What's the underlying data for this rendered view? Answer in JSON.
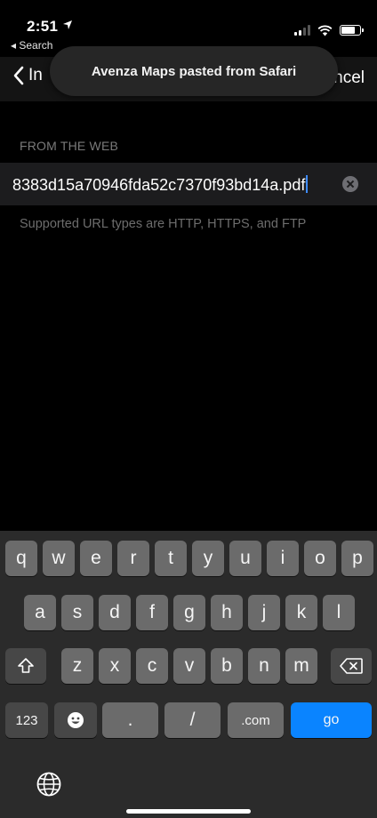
{
  "status_bar": {
    "time": "2:51",
    "back_app": "◂ Search"
  },
  "nav": {
    "back_label": "In",
    "cancel_label": "ncel"
  },
  "toast": {
    "message": "Avenza Maps pasted from Safari"
  },
  "form": {
    "section_header": "FROM THE WEB",
    "url_value": "8383d15a70946fda52c7370f93bd14a.pdf",
    "footer_note": "Supported URL types are HTTP, HTTPS, and FTP"
  },
  "keyboard": {
    "row1": [
      "q",
      "w",
      "e",
      "r",
      "t",
      "y",
      "u",
      "i",
      "o",
      "p"
    ],
    "row2": [
      "a",
      "s",
      "d",
      "f",
      "g",
      "h",
      "j",
      "k",
      "l"
    ],
    "row3": [
      "z",
      "x",
      "c",
      "v",
      "b",
      "n",
      "m"
    ],
    "numbers_key": "123",
    "period_key": ".",
    "slash_key": "/",
    "dotcom_key": ".com",
    "go_key": "go"
  },
  "icons": {
    "location": "location-arrow-icon",
    "signal": "cellular-signal-icon",
    "wifi": "wifi-icon",
    "battery": "battery-icon",
    "back": "chevron-left-icon",
    "clear": "clear-circle-icon",
    "shift": "shift-arrow-icon",
    "delete": "backspace-icon",
    "emoji": "emoji-icon",
    "globe": "globe-icon"
  },
  "colors": {
    "accent": "#0a84ff",
    "key": "#6b6b6b",
    "keyboard_bg": "#2b2b2b"
  }
}
